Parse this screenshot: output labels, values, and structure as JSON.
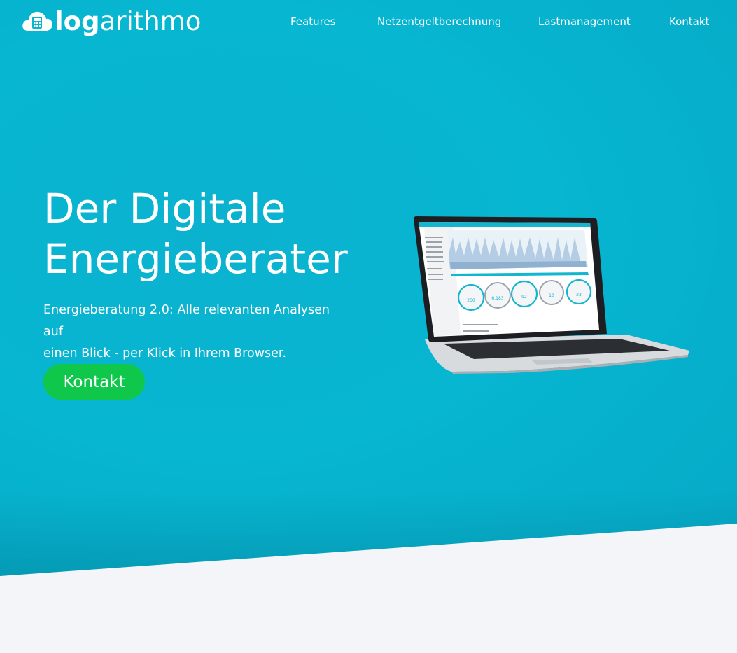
{
  "brand": {
    "logo_bold": "log",
    "logo_light": "arithmo",
    "logo_icon": "cloud-calculator-icon"
  },
  "nav": {
    "items": [
      {
        "label": "Features"
      },
      {
        "label": "Netzentgeltberechnung"
      },
      {
        "label": "Lastmanagement"
      },
      {
        "label": "Kontakt"
      }
    ]
  },
  "hero": {
    "headline_line1": "Der Digitale",
    "headline_line2": "Energieberater",
    "subtext_line1": "Energieberatung 2.0: Alle relevanten Analysen auf",
    "subtext_line2": "einen Blick - per Klick in Ihrem Browser.",
    "cta_label": "Kontakt"
  },
  "laptop_screen": {
    "gauges": [
      {
        "value": "250"
      },
      {
        "value": "6.183"
      },
      {
        "value": "92"
      },
      {
        "value": "10"
      },
      {
        "value": "23"
      }
    ]
  },
  "colors": {
    "hero_bg": "#07b6d1",
    "cta_bg": "#0fc84b",
    "page_bg": "#f3f5f9",
    "text": "#ffffff"
  }
}
